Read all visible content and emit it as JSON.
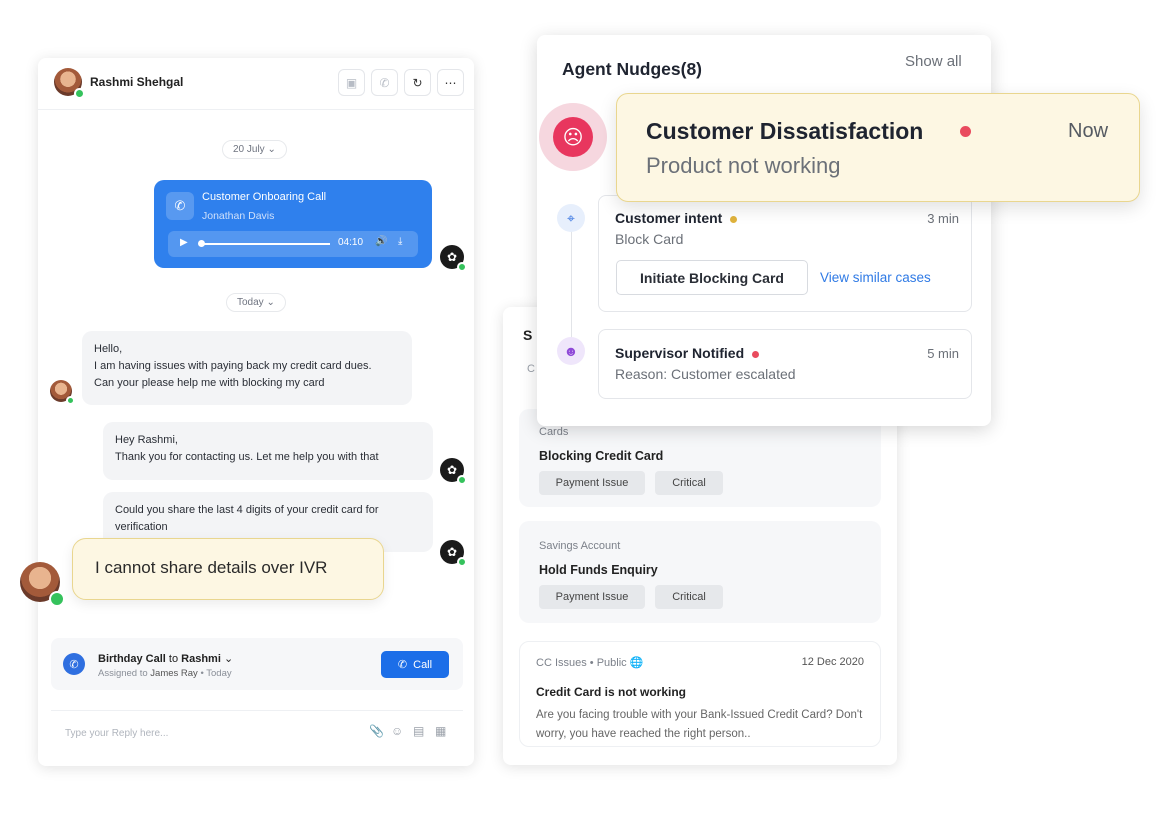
{
  "chat": {
    "contact_name": "Rashmi Shehgal",
    "header_icons": [
      "video-icon",
      "phone-icon",
      "refresh-icon",
      "more-icon"
    ],
    "date_chip_1": "20 July",
    "date_chip_2": "Today",
    "call_card": {
      "title": "Customer Onboaring Call",
      "agent": "Jonathan Davis",
      "duration": "04:10"
    },
    "messages": {
      "customer_1": [
        "Hello,",
        "I am having issues with paying back my credit card dues.",
        "Can your please help me with blocking my card"
      ],
      "agent_1": [
        "Hey Rashmi,",
        "Thank you for contacting us. Let me help you with that"
      ],
      "agent_2": [
        "Could you share the last 4 digits of your credit card for",
        "verification"
      ],
      "customer_2": "I cannot share details over IVR"
    },
    "birthday": {
      "title_bold_1": "Birthday Call",
      "title_mid": " to ",
      "title_bold_2": "Rashmi",
      "assigned_prefix": "Assigned to ",
      "assignee": "James Ray",
      "assigned_suffix": " • Today",
      "button": "Call"
    },
    "reply_placeholder": "Type your Reply here..."
  },
  "cases": {
    "title_partial": "S",
    "search_partial": "C",
    "items": [
      {
        "category": "Cards",
        "name": "Blocking Credit Card",
        "tags": [
          "Payment Issue",
          "Critical"
        ]
      },
      {
        "category": "Savings Account",
        "name": "Hold Funds Enquiry",
        "tags": [
          "Payment Issue",
          "Critical"
        ]
      }
    ],
    "kb": {
      "meta": "CC Issues  •  Public",
      "date": "12 Dec 2020",
      "title": "Credit Card is not working",
      "desc": "Are you facing trouble with your Bank-Issued Credit Card? Don't worry, you have reached the right person.."
    }
  },
  "nudges": {
    "title": "Agent Nudges(8)",
    "show_all": "Show all",
    "dissatisfaction": {
      "title": "Customer Dissatisfaction",
      "time": "Now",
      "subtitle": "Product not working"
    },
    "intent": {
      "title": "Customer intent",
      "time": "3 min",
      "subtitle": "Block Card",
      "button": "Initiate Blocking Card",
      "link": "View similar cases"
    },
    "supervisor": {
      "title": "Supervisor Notified",
      "time": "5 min",
      "subtitle": "Reason: Customer escalated"
    }
  },
  "colors": {
    "primary": "#2f80ed",
    "alert_red": "#e94b5e",
    "warning_amber": "#e0b33c",
    "highlight_bg": "#fdf7e3",
    "whatsapp_green": "#35c25c"
  }
}
